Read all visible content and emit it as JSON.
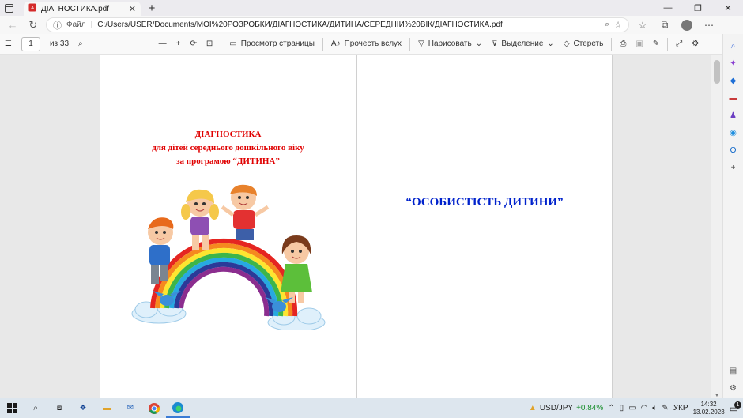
{
  "browser": {
    "tab_title": "ДІАГНОСТИКА.pdf",
    "url_site_label": "Файл",
    "url_path": "C:/Users/USER/Documents/МОЇ%20РОЗРОБКИ/ДІАГНОСТИКА/ДИТИНА/СЕРЕДНІЙ%20ВІК/ДІАГНОСТИКА.pdf"
  },
  "pdf_toolbar": {
    "page_current": "1",
    "page_total": "из 33",
    "view_label": "Просмотр страницы",
    "read_aloud_label": "Прочесть вслух",
    "draw_label": "Нарисовать",
    "highlight_label": "Выделение",
    "erase_label": "Стереть"
  },
  "document": {
    "left_page": {
      "line1": "ДІАГНОСТИКА",
      "line2": "для дітей середнього дошкільного віку",
      "line3": "за програмою “ДИТИНА”"
    },
    "right_page": {
      "title": "“ОСОБИСТІСТЬ ДИТИНИ”"
    }
  },
  "taskbar": {
    "stock_label": "USD/JPY",
    "stock_change": "+0.84%",
    "language": "УКР",
    "time": "14:32",
    "date": "13.02.2023",
    "notification_count": "1"
  },
  "colors": {
    "doc_title_red": "#e00000",
    "doc_title_blue": "#0022cc",
    "stock_green": "#1a8f2d"
  }
}
